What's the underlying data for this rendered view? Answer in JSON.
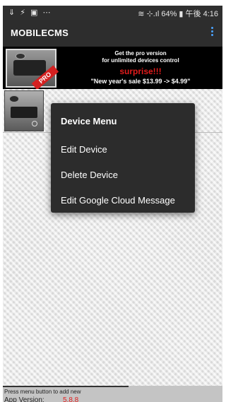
{
  "status_bar": {
    "left_icons": "⇓ ⚡ ▣ ⋯",
    "right_text": "≋ ⊹.ıl 64% ▮ 午後 4:16"
  },
  "app_bar": {
    "title": "MOBILECMS",
    "overflow_icon": "more-vert-icon"
  },
  "banner": {
    "line1": "Get the pro version",
    "line2": "for unlimited devices control",
    "surprise": "surprise!!!",
    "sale": "\"New year's sale  $13.99 -> $4.99\"",
    "badge": "PRO"
  },
  "context_menu": {
    "title": "Device Menu",
    "items": [
      {
        "label": "Edit Device"
      },
      {
        "label": "Delete Device"
      },
      {
        "label": "Edit Google Cloud Message"
      }
    ]
  },
  "footer": {
    "hint": "Press menu button to add new",
    "version_label": "App Version:",
    "version_value": "5.8.8"
  },
  "colors": {
    "app_bar": "#2d2d2d",
    "menu_bg": "#2c2c2c",
    "overflow_dots": "#4aa3ff",
    "surprise_text": "#e21b1b",
    "version_value": "#e02020"
  }
}
